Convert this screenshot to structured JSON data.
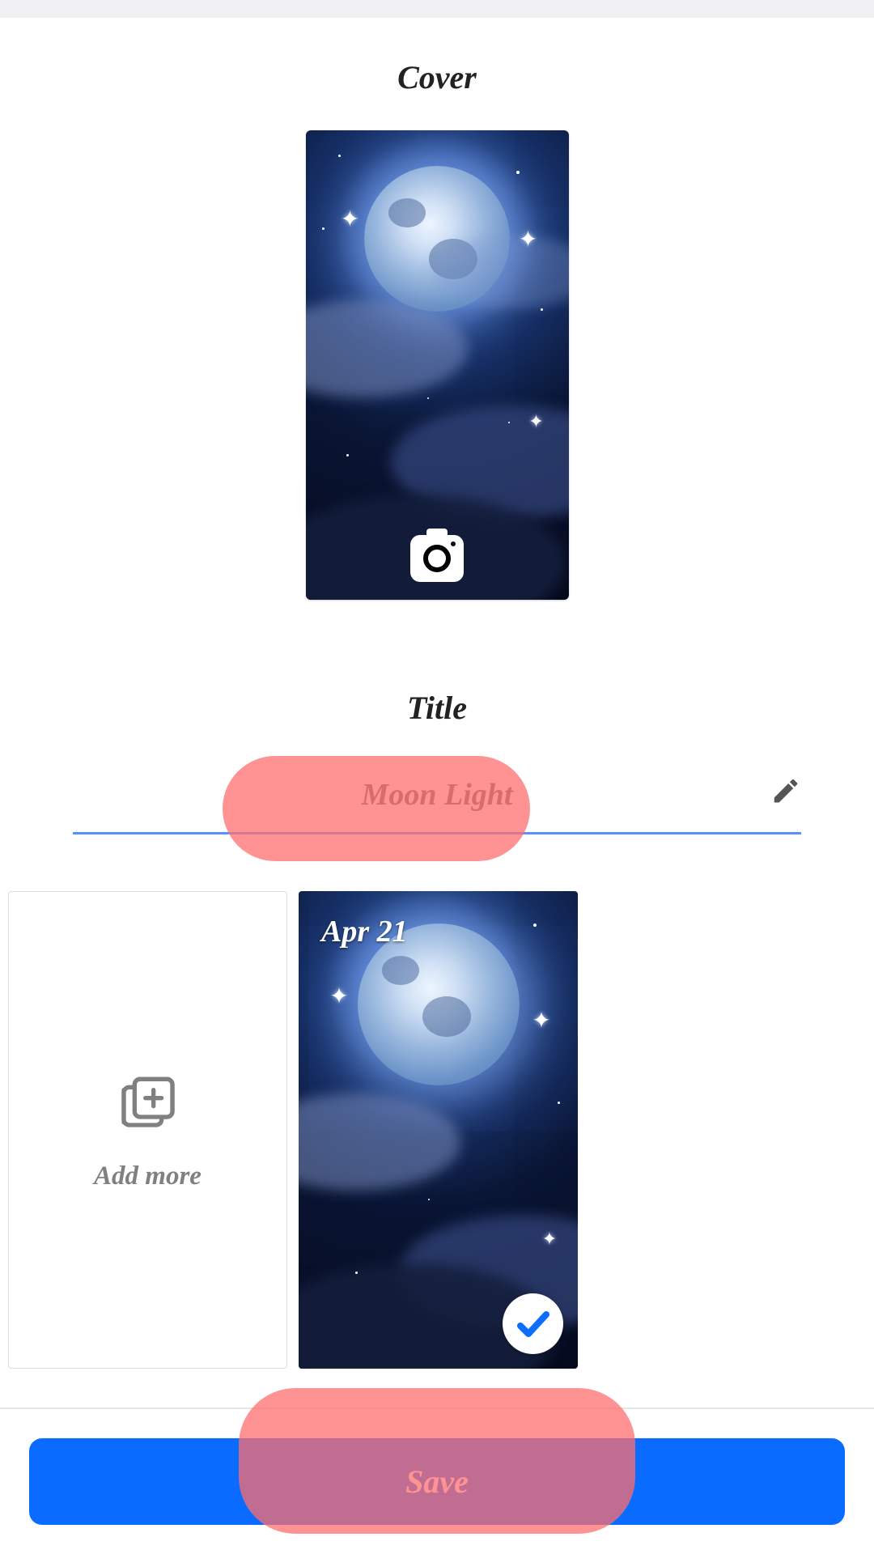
{
  "sections": {
    "cover_label": "Cover",
    "title_label": "Title"
  },
  "title": {
    "value": "Moon Light"
  },
  "gallery": {
    "add_more_label": "Add more",
    "items": [
      {
        "date": "Apr 21",
        "selected": true
      }
    ]
  },
  "footer": {
    "save_label": "Save"
  },
  "icons": {
    "camera": "camera-icon",
    "pencil": "pencil-icon",
    "add_stack": "add-stack-icon",
    "check": "check-icon"
  },
  "highlights": {
    "title_pill": true,
    "save_pill": true
  }
}
